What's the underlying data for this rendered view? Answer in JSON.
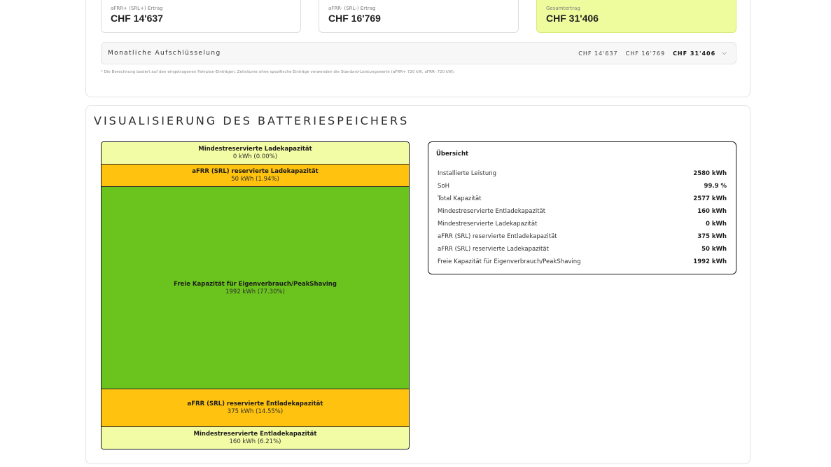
{
  "revenue": {
    "afrr_plus": {
      "label": "aFRR+ (SRL+) Ertrag",
      "value": "CHF 14'637"
    },
    "afrr_minus": {
      "label": "aFRR- (SRL-) Ertrag",
      "value": "CHF 16'769"
    },
    "total": {
      "label": "Gesamtertrag",
      "value": "CHF 31'406"
    }
  },
  "monthly": {
    "title": "Monatliche Aufschlüsselung",
    "plus": "CHF 14'637",
    "minus": "CHF 16'769",
    "total": "CHF 31'406"
  },
  "footnote": "* Die Berechnung basiert auf den eingetragenen Fahrplan-Einträgen. Zeiträume ohne spezifische Einträge verwenden die Standard-Leistungswerte (aFRR+ 720 kW, aFRR- 720 kW).",
  "visualization": {
    "title": "VISUALISIERUNG DES BATTERIESPEICHERS",
    "segments": {
      "min_charge": {
        "title": "Mindestreservierte Ladekapazität",
        "value": "0 kWh (0.00%)",
        "color": "#f2fca4"
      },
      "afrr_charge": {
        "title": "aFRR (SRL) reservierte Ladekapazität",
        "value": "50 kWh (1.94%)",
        "color": "#ffc20e"
      },
      "free": {
        "title": "Freie Kapazität für Eigenverbrauch/PeakShaving",
        "value": "1992 kWh (77.30%)",
        "color": "#6ac41d"
      },
      "afrr_discharge": {
        "title": "aFRR (SRL) reservierte Entladekapazität",
        "value": "375 kWh (14.55%)",
        "color": "#ffc20e"
      },
      "min_discharge": {
        "title": "Mindestreservierte Entladekapazität",
        "value": "160 kWh (6.21%)",
        "color": "#f2fca4"
      }
    }
  },
  "overview": {
    "title": "Übersicht",
    "rows": [
      {
        "label": "Installierte Leistung",
        "value": "2580 kWh"
      },
      {
        "label": "SoH",
        "value": "99.9 %"
      },
      {
        "label": "Total Kapazität",
        "value": "2577 kWh"
      },
      {
        "label": "Mindestreservierte Entladekapazität",
        "value": "160 kWh"
      },
      {
        "label": "Mindestreservierte Ladekapazität",
        "value": "0 kWh"
      },
      {
        "label": "aFRR (SRL) reservierte Entladekapazität",
        "value": "375 kWh"
      },
      {
        "label": "aFRR (SRL) reservierte Ladekapazität",
        "value": "50 kWh"
      },
      {
        "label": "Freie Kapazität für Eigenverbrauch/PeakShaving",
        "value": "1992 kWh"
      }
    ]
  },
  "icons": {
    "monthly_toggle": "chevron-down-icon"
  }
}
